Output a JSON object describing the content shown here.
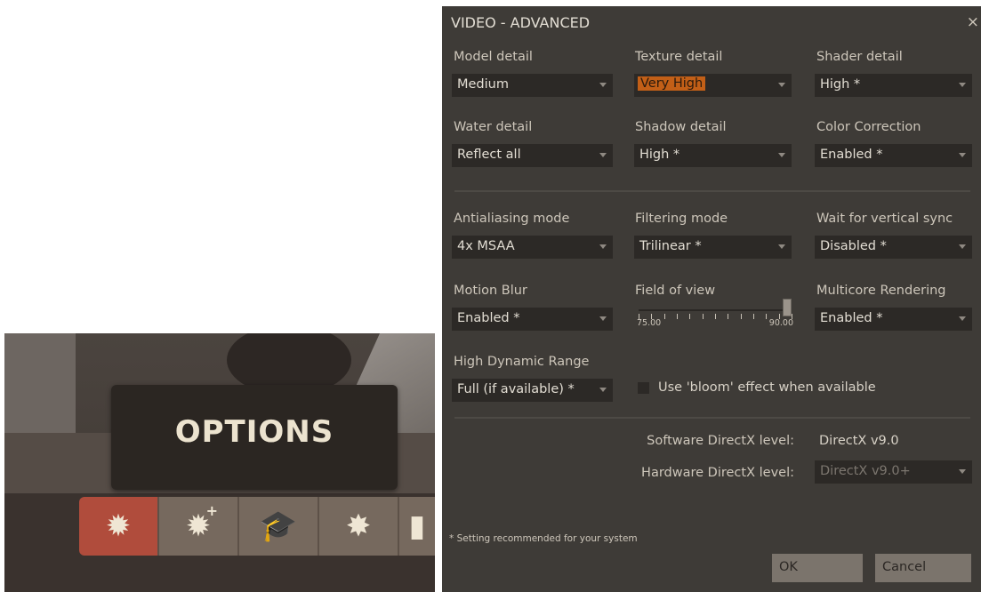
{
  "scene": {
    "tooltip_text": "OPTIONS",
    "icons": [
      {
        "name": "gear-icon",
        "glyph": "✹",
        "active": true
      },
      {
        "name": "advanced-gear-icon",
        "glyph": "✹",
        "plus": "+",
        "active": false
      },
      {
        "name": "graduation-cap-icon",
        "glyph": "🎓",
        "active": false
      },
      {
        "name": "badge-icon",
        "glyph": "✸",
        "active": false
      },
      {
        "name": "chat-bubble-icon",
        "glyph": "▮",
        "active": false
      }
    ]
  },
  "dialog": {
    "title": "VIDEO - ADVANCED",
    "close": "×",
    "model_detail": {
      "label": "Model detail",
      "value": "Medium"
    },
    "texture_detail": {
      "label": "Texture detail",
      "value": "Very High"
    },
    "shader_detail": {
      "label": "Shader detail",
      "value": "High *"
    },
    "water_detail": {
      "label": "Water detail",
      "value": "Reflect all"
    },
    "shadow_detail": {
      "label": "Shadow detail",
      "value": "High *"
    },
    "color_correction": {
      "label": "Color Correction",
      "value": "Enabled *"
    },
    "antialiasing": {
      "label": "Antialiasing mode",
      "value": "4x MSAA"
    },
    "filtering": {
      "label": "Filtering mode",
      "value": "Trilinear *"
    },
    "vsync": {
      "label": "Wait for vertical sync",
      "value": "Disabled *"
    },
    "motion_blur": {
      "label": "Motion Blur",
      "value": "Enabled *"
    },
    "fov": {
      "label": "Field of view",
      "min": "75.00",
      "max": "90.00",
      "level": 1.0
    },
    "multicore": {
      "label": "Multicore Rendering",
      "value": "Enabled *"
    },
    "hdr": {
      "label": "High Dynamic Range",
      "value": "Full (if available) *"
    },
    "bloom": {
      "label": "Use 'bloom' effect when available",
      "checked": false
    },
    "software_dx": {
      "label": "Software DirectX level:",
      "value": "DirectX v9.0"
    },
    "hardware_dx": {
      "label": "Hardware DirectX level:",
      "value": "DirectX v9.0+"
    },
    "footnote": "* Setting recommended for your system",
    "ok": "OK",
    "cancel": "Cancel"
  }
}
